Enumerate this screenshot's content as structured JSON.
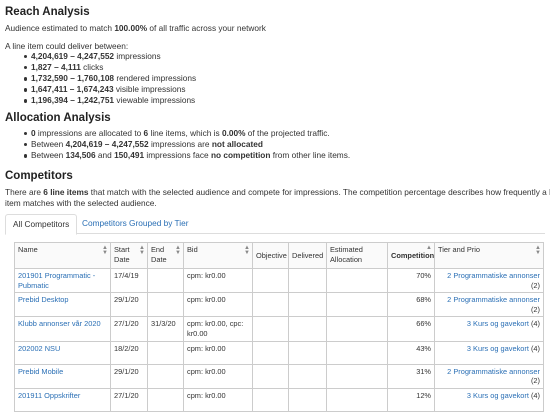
{
  "reach": {
    "title": "Reach Analysis",
    "audience_prefix": "Audience estimated to match ",
    "audience_pct": "100.00%",
    "audience_suffix": " of all traffic across your network",
    "deliver_intro": "A line item could deliver between:",
    "items": [
      {
        "range": "4,204,619 – 4,247,552",
        "label": " impressions"
      },
      {
        "range": "1,827 – 4,111",
        "label": " clicks"
      },
      {
        "range": "1,732,590 – 1,760,108",
        "label": " rendered impressions"
      },
      {
        "range": "1,647,411 – 1,674,243",
        "label": " visible impressions"
      },
      {
        "range": "1,196,394 – 1,242,751",
        "label": " viewable impressions"
      }
    ]
  },
  "allocation": {
    "title": "Allocation Analysis",
    "b1_a": "0",
    "b1_b": " impressions are allocated to ",
    "b1_c": "6",
    "b1_d": " line items, which is ",
    "b1_e": "0.00%",
    "b1_f": " of the projected traffic.",
    "b2_a": "Between ",
    "b2_b": "4,204,619 – 4,247,552",
    "b2_c": " impressions are ",
    "b2_d": "not allocated",
    "b3_a": "Between ",
    "b3_b": "134,506",
    "b3_c": " and ",
    "b3_d": "150,491",
    "b3_e": " impressions face ",
    "b3_f": "no competition",
    "b3_g": " from other line items."
  },
  "competitors": {
    "title": "Competitors",
    "desc_a": "There are ",
    "desc_b": "6 line items",
    "desc_c": " that match with the selected audience and compete for impressions. The competition percentage describes how frequently a line",
    "desc_d": "item matches with the selected audience.",
    "tabs": [
      "All Competitors",
      "Competitors Grouped by Tier"
    ],
    "columns": [
      "Name",
      "Start Date",
      "End Date",
      "Bid",
      "Objective",
      "Delivered",
      "Estimated Allocation",
      "Competition",
      "Tier and Prio"
    ],
    "rows": [
      {
        "name": "201901 Programmatic - Pubmatic",
        "start": "17/4/19",
        "end": "",
        "bid": "cpm: kr0.00",
        "objective": "",
        "delivered": "",
        "alloc": "",
        "competition": "70%",
        "tier": "2 Programmatiske annonser",
        "prio": " (2)"
      },
      {
        "name": "Prebid Desktop",
        "start": "29/1/20",
        "end": "",
        "bid": "cpm: kr0.00",
        "objective": "",
        "delivered": "",
        "alloc": "",
        "competition": "68%",
        "tier": "2 Programmatiske annonser",
        "prio": " (2)"
      },
      {
        "name": "Klubb annonser vår 2020",
        "start": "27/1/20",
        "end": "31/3/20",
        "bid": "cpm: kr0.00, cpc: kr0.00",
        "objective": "",
        "delivered": "",
        "alloc": "",
        "competition": "66%",
        "tier": "3 Kurs og gavekort",
        "prio": " (4)"
      },
      {
        "name": "202002 NSU",
        "start": "18/2/20",
        "end": "",
        "bid": "cpm: kr0.00",
        "objective": "",
        "delivered": "",
        "alloc": "",
        "competition": "43%",
        "tier": "3 Kurs og gavekort",
        "prio": " (4)"
      },
      {
        "name": "Prebid Mobile",
        "start": "29/1/20",
        "end": "",
        "bid": "cpm: kr0.00",
        "objective": "",
        "delivered": "",
        "alloc": "",
        "competition": "31%",
        "tier": "2 Programmatiske annonser",
        "prio": " (2)"
      },
      {
        "name": "201911 Oppskrifter",
        "start": "27/1/20",
        "end": "",
        "bid": "cpm: kr0.00",
        "objective": "",
        "delivered": "",
        "alloc": "",
        "competition": "12%",
        "tier": "3 Kurs og gavekort",
        "prio": " (4)"
      }
    ]
  }
}
